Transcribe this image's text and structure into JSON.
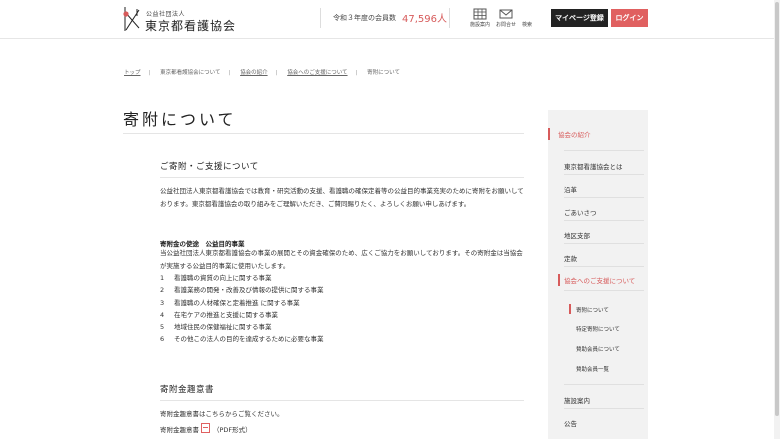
{
  "header": {
    "logo_small": "公益社団法人",
    "logo_big": "東京都看護協会",
    "member_label": "令和３年度の会員数",
    "member_count": "47,596人",
    "icons": [
      {
        "name": "facility-icon",
        "label": "施設案内"
      },
      {
        "name": "mail-icon",
        "label": "お問合せ"
      },
      {
        "name": "search-icon",
        "label": "検索"
      }
    ],
    "mypage_button": "マイページ登録",
    "login_button": "ログイン",
    "accent_color": "#e06060"
  },
  "breadcrumb": [
    {
      "label": "トップ",
      "link": true
    },
    {
      "label": "東京都看護協会について",
      "link": false
    },
    {
      "label": "協会の紹介",
      "link": true
    },
    {
      "label": "協会へのご支援について",
      "link": true
    },
    {
      "label": "寄附について",
      "link": false
    }
  ],
  "page_title": "寄附について",
  "section1": {
    "heading": "ご寄附・ご支援について",
    "intro": "公益社団法人東京都看護協会では教育・研究活動の支援、看護職の確保定着等の公益目的事業充実のために寄附をお願いしております。東京都看護協会の取り組みをご理解いただき、ご賛同賜りたく、よろしくお願い申しあげます。",
    "purpose_heading": "寄附金の使途　公益目的事業",
    "purpose_text": "当公益社団法人東京都看護協会の事業の展開とその資金確保のため、広くご協力をお願いしております。その寄附金は当協会が実施する公益目的事業に使用いたします。",
    "items": [
      {
        "num": "1",
        "text": "看護職の資質の向上に関する事業"
      },
      {
        "num": "2",
        "text": "看護業務の開発・改善及び情報の提供に関する事業"
      },
      {
        "num": "3",
        "text": "看護職の人材確保と定着推進 に関する事業"
      },
      {
        "num": "4",
        "text": "在宅ケアの推進と支援に関する事業"
      },
      {
        "num": "5",
        "text": "地域住民の保健福祉に関する事業"
      },
      {
        "num": "6",
        "text": "その他この法人の目的を達成するために必要な事業"
      }
    ]
  },
  "section2": {
    "heading": "寄附金趣意書",
    "text": "寄附金趣意書はこちらからご覧ください。",
    "doc_link": "寄附金趣意書",
    "doc_format": "（PDF形式）"
  },
  "sidebar": {
    "section_title": "協会の紹介",
    "items": [
      {
        "label": "東京都看護協会とは"
      },
      {
        "label": "沿革"
      },
      {
        "label": "ごあいさつ"
      },
      {
        "label": "地区支部"
      },
      {
        "label": "定款"
      }
    ],
    "support_title": "協会へのご支援について",
    "sub_items": [
      {
        "label": "寄附について",
        "active": true
      },
      {
        "label": "特定寄附について",
        "active": false
      },
      {
        "label": "賛助会員について",
        "active": false
      },
      {
        "label": "賛助会員一覧",
        "active": false
      }
    ],
    "bottom_items": [
      {
        "label": "施設案内"
      },
      {
        "label": "公告"
      }
    ]
  }
}
